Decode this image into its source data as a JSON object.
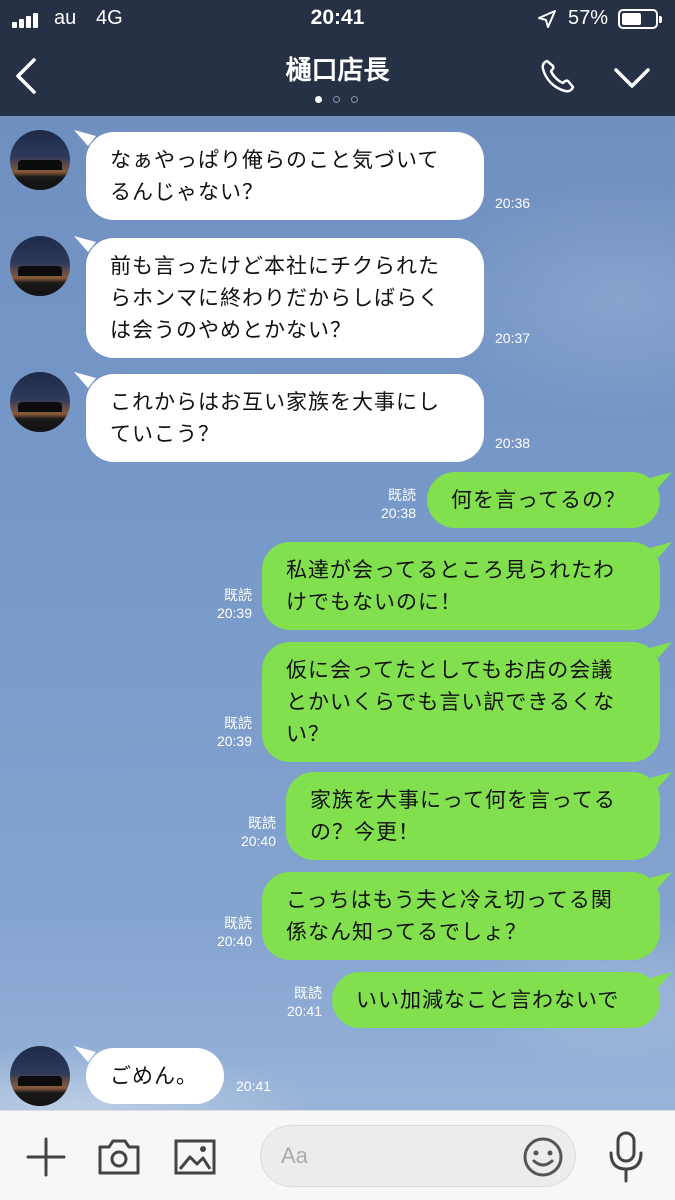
{
  "status_bar": {
    "carrier": "au",
    "network": "4G",
    "time": "20:41",
    "battery": "57%"
  },
  "header": {
    "title": "樋口店長",
    "back_icon": "chevron-left-icon",
    "call_icon": "phone-icon",
    "menu_icon": "chevron-down-icon"
  },
  "messages": [
    {
      "side": "in",
      "text": "なぁやっぱり俺らのこと気づいてるんじゃない？",
      "lines": [
        "なぁやっぱり俺らのこと気づいて",
        "るんじゃない？"
      ],
      "time": "20:36"
    },
    {
      "side": "in",
      "text": "前も言ったけど本社にチクられたらホンマに終わりだからしばらくは会うのやめとかない？",
      "lines": [
        "前も言ったけど本社にチクられた",
        "らホンマに終わりだからしばらく",
        "は会うのやめとかない？"
      ],
      "time": "20:37"
    },
    {
      "side": "in",
      "text": "これからはお互い家族を大事にしていこう？",
      "lines": [
        "これからはお互い家族を大事にし",
        "ていこう？"
      ],
      "time": "20:38"
    },
    {
      "side": "out",
      "read": "既読",
      "time": "20:38",
      "lines": [
        "何を言ってるの？"
      ]
    },
    {
      "side": "out",
      "read": "既読",
      "time": "20:39",
      "lines": [
        "私達が会ってるところ見られたわ",
        "けでもないのに！"
      ]
    },
    {
      "side": "out",
      "read": "既読",
      "time": "20:39",
      "lines": [
        "仮に会ってたとしてもお店の会議",
        "とかいくらでも言い訳できるくな",
        "い？"
      ]
    },
    {
      "side": "out",
      "read": "既読",
      "time": "20:40",
      "lines": [
        "家族を大事にって何を言ってる",
        "の？今更！"
      ]
    },
    {
      "side": "out",
      "read": "既読",
      "time": "20:40",
      "lines": [
        "こっちはもう夫と冷え切ってる関",
        "係なん知ってるでしょ？"
      ]
    },
    {
      "side": "out",
      "read": "既読",
      "time": "20:41",
      "lines": [
        "いい加減なこと言わないで"
      ]
    },
    {
      "side": "in",
      "lines": [
        "ごめん。"
      ],
      "time": "20:41"
    }
  ],
  "input_bar": {
    "placeholder": "Aa",
    "icons": [
      "plus-icon",
      "camera-icon",
      "image-icon",
      "emoji-icon",
      "microphone-icon"
    ]
  },
  "colors": {
    "header_bg": "#263145",
    "bubble_out": "#82e04e",
    "bubble_in": "#ffffff"
  }
}
